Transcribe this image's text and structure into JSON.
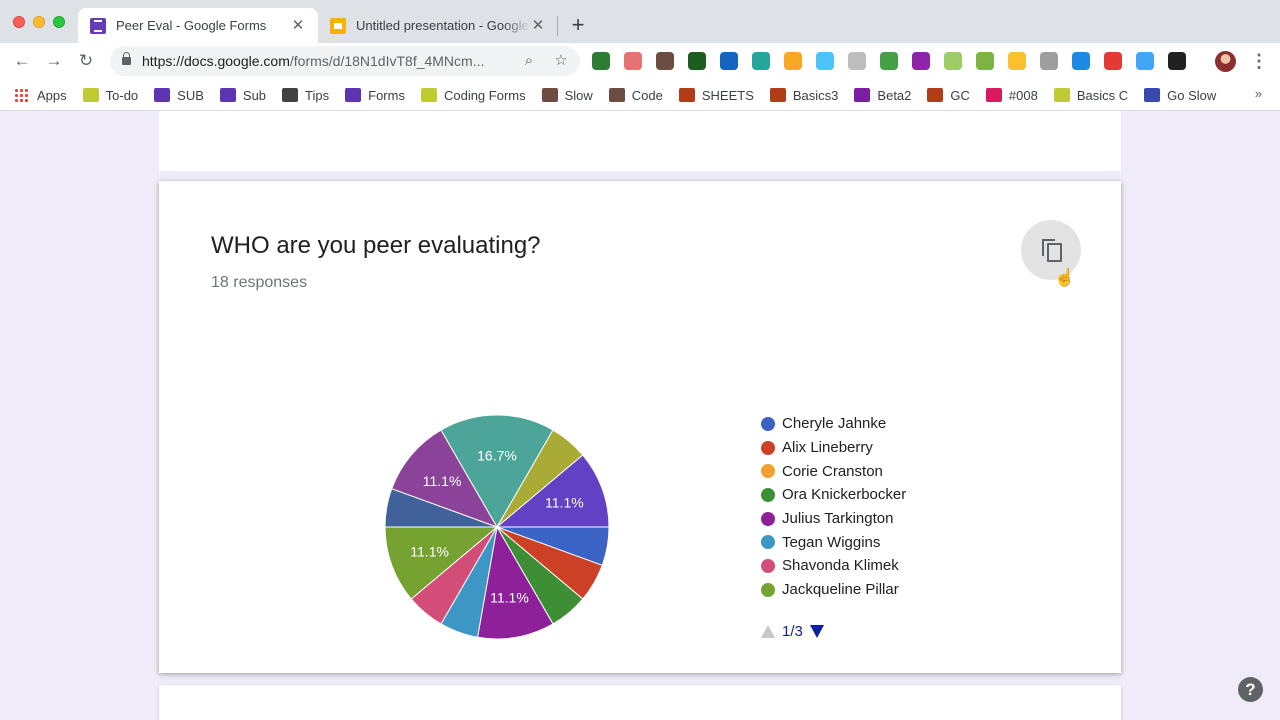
{
  "browser": {
    "tabs": [
      {
        "title": "Peer Eval - Google Forms",
        "active": true,
        "icon": "forms-icon"
      },
      {
        "title": "Untitled presentation - Google Slides",
        "active": false,
        "icon": "slides-icon"
      }
    ],
    "close_glyph": "✕",
    "new_tab_glyph": "+",
    "back_glyph": "←",
    "forward_glyph": "→",
    "reload_glyph": "↻",
    "url_host": "https://docs.google.com",
    "url_path": "/forms/d/18N1dIvT8f_4MNcm...",
    "zoom_glyph": "⌕",
    "star_glyph": "☆",
    "menu_glyph": "⋮",
    "extension_colors": [
      "#2e7d32",
      "#e57373",
      "#6d4c41",
      "#1b5e20",
      "#1565c0",
      "#26a69a",
      "#f9a825",
      "#4fc3f7",
      "#bdbdbd",
      "#43a047",
      "#8e24aa",
      "#9ccc65",
      "#7cb342",
      "#fbc02d",
      "#9e9e9e",
      "#1e88e5",
      "#e53935",
      "#42a5f5",
      "#212121"
    ],
    "bookmarks": [
      {
        "label": "Apps",
        "color": "apps"
      },
      {
        "label": "To-do",
        "color": "#c0ca33"
      },
      {
        "label": "SUB",
        "color": "#5e35b1"
      },
      {
        "label": "Sub",
        "color": "#5e35b1"
      },
      {
        "label": "Tips",
        "color": "#424242"
      },
      {
        "label": "Forms",
        "color": "#5e35b1"
      },
      {
        "label": "Coding Forms",
        "color": "#c0ca33"
      },
      {
        "label": "Slow",
        "color": "#6d4c41"
      },
      {
        "label": "Code",
        "color": "#6d4c41"
      },
      {
        "label": "SHEETS",
        "color": "#b23c17"
      },
      {
        "label": "Basics3",
        "color": "#b23c17"
      },
      {
        "label": "Beta2",
        "color": "#7b1fa2"
      },
      {
        "label": "GC",
        "color": "#b23c17"
      },
      {
        "label": "#008",
        "color": "#d81b60"
      },
      {
        "label": "Basics C",
        "color": "#c0ca33"
      },
      {
        "label": "Go Slow",
        "color": "#3949ab"
      }
    ],
    "bookmarks_more": "»"
  },
  "question": {
    "title": "WHO are you peer evaluating?",
    "responses": "18 responses",
    "copy_icon": "copy-icon"
  },
  "chart_data": {
    "type": "pie",
    "total_responses": 18,
    "slices": [
      {
        "label": "Cheryle Jahnke",
        "value": 1,
        "pct": "5.6%",
        "color": "#3b63c6",
        "show_label": false
      },
      {
        "label": "Alix Lineberry",
        "value": 1,
        "pct": "5.6%",
        "color": "#cc4125",
        "show_label": false
      },
      {
        "label": "Ora Knickerbocker",
        "value": 1,
        "pct": "5.6%",
        "color": "#3e8e36",
        "show_label": false
      },
      {
        "label": "Julius Tarkington",
        "value": 2,
        "pct": "11.1%",
        "color": "#8e2199",
        "show_label": true
      },
      {
        "label": "Tegan Wiggins",
        "value": 1,
        "pct": "5.6%",
        "color": "#3c97c4",
        "show_label": false
      },
      {
        "label": "Shavonda Klimek",
        "value": 1,
        "pct": "5.6%",
        "color": "#d24d78",
        "show_label": false
      },
      {
        "label": "Jackqueline Pillar",
        "value": 2,
        "pct": "11.1%",
        "color": "#76a232",
        "show_label": true
      },
      {
        "label": "",
        "value": 1,
        "pct": "5.6%",
        "color": "#40619a",
        "show_label": false
      },
      {
        "label": "",
        "value": 2,
        "pct": "11.1%",
        "color": "#8b4399",
        "show_label": true
      },
      {
        "label": "",
        "value": 3,
        "pct": "16.7%",
        "color": "#4da599",
        "show_label": true
      },
      {
        "label": "",
        "value": 1,
        "pct": "5.6%",
        "color": "#aaaa36",
        "show_label": false
      },
      {
        "label": "",
        "value": 2,
        "pct": "11.1%",
        "color": "#6341c4",
        "show_label": true
      }
    ],
    "legend": [
      {
        "label": "Cheryle Jahnke",
        "color": "#3b63c6"
      },
      {
        "label": "Alix Lineberry",
        "color": "#cc4125"
      },
      {
        "label": "Corie Cranston",
        "color": "#f0a030"
      },
      {
        "label": "Ora Knickerbocker",
        "color": "#3e8e36"
      },
      {
        "label": "Julius Tarkington",
        "color": "#8e2199"
      },
      {
        "label": "Tegan Wiggins",
        "color": "#3c97c4"
      },
      {
        "label": "Shavonda Klimek",
        "color": "#d24d78"
      },
      {
        "label": "Jackqueline Pillar",
        "color": "#76a232"
      }
    ],
    "legend_placement": "right",
    "legend_page": "1/3"
  },
  "help": {
    "glyph": "?"
  }
}
